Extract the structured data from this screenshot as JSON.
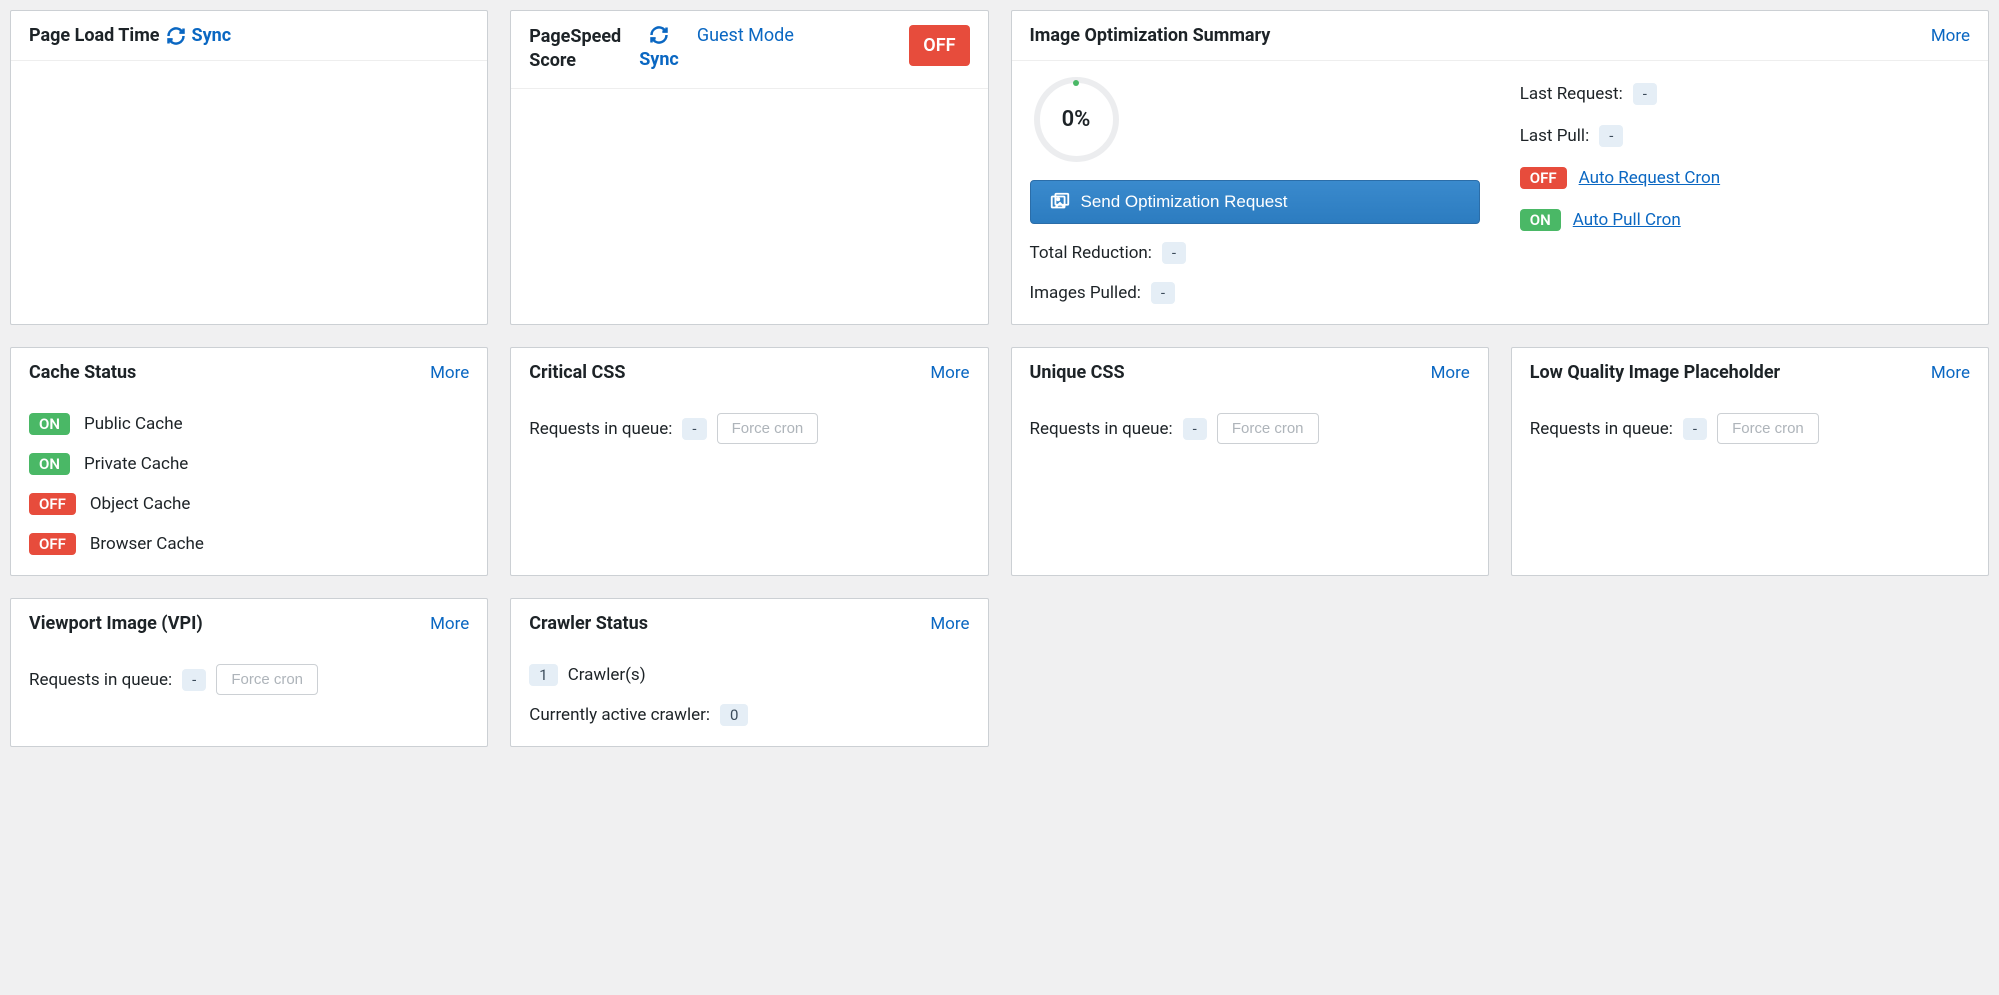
{
  "labels": {
    "more": "More",
    "sync": "Sync",
    "queue": "Requests in queue:",
    "force_cron": "Force cron",
    "off": "OFF",
    "on": "ON",
    "dash": "-"
  },
  "pageLoad": {
    "title": "Page Load Time"
  },
  "pageSpeed": {
    "title_line1": "PageSpeed",
    "title_line2": "Score",
    "guest_mode": "Guest Mode",
    "off": "OFF"
  },
  "imgOpt": {
    "title": "Image Optimization Summary",
    "percent": "0%",
    "send_btn": "Send Optimization Request",
    "total_reduction_label": "Total Reduction:",
    "total_reduction_value": "-",
    "images_pulled_label": "Images Pulled:",
    "images_pulled_value": "-",
    "last_request_label": "Last Request:",
    "last_request_value": "-",
    "last_pull_label": "Last Pull:",
    "last_pull_value": "-",
    "auto_request_cron": "Auto Request Cron",
    "auto_pull_cron": "Auto Pull Cron"
  },
  "cacheStatus": {
    "title": "Cache Status",
    "items": [
      {
        "status": "ON",
        "label": "Public Cache"
      },
      {
        "status": "ON",
        "label": "Private Cache"
      },
      {
        "status": "OFF",
        "label": "Object Cache"
      },
      {
        "status": "OFF",
        "label": "Browser Cache"
      }
    ]
  },
  "criticalCSS": {
    "title": "Critical CSS",
    "queue_value": "-"
  },
  "uniqueCSS": {
    "title": "Unique CSS",
    "queue_value": "-"
  },
  "lqip": {
    "title": "Low Quality Image Placeholder",
    "queue_value": "-"
  },
  "vpi": {
    "title": "Viewport Image (VPI)",
    "queue_value": "-"
  },
  "crawler": {
    "title": "Crawler Status",
    "count": "1",
    "crawlers_label": "Crawler(s)",
    "active_label": "Currently active crawler:",
    "active_value": "0"
  }
}
